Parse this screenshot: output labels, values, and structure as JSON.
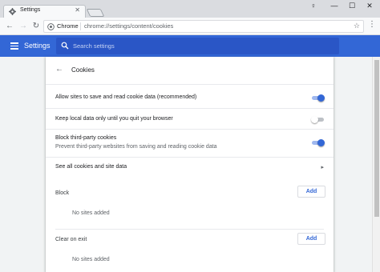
{
  "tab": {
    "title": "Settings",
    "close": "✕"
  },
  "window_controls": {
    "user": "♀",
    "minimize": "—",
    "maximize": "☐",
    "close": "✕"
  },
  "toolbar": {
    "back": "←",
    "forward": "→",
    "reload": "↻",
    "chip": "Chrome",
    "url": "chrome://settings/content/cookies",
    "star": "☆",
    "menu": "⋮"
  },
  "header": {
    "title": "Settings",
    "search_placeholder": "Search settings"
  },
  "page": {
    "back": "←",
    "title": "Cookies"
  },
  "settings": [
    {
      "label": "Allow sites to save and read cookie data (recommended)",
      "enabled": true
    },
    {
      "label": "Keep local data only until you quit your browser",
      "enabled": false
    },
    {
      "label": "Block third-party cookies",
      "sublabel": "Prevent third-party websites from saving and reading cookie data",
      "enabled": true
    }
  ],
  "see_all": {
    "label": "See all cookies and site data",
    "chevron": "▸"
  },
  "lists": {
    "block": {
      "label": "Block",
      "add": "Add",
      "empty": "No sites added"
    },
    "clear_on_exit": {
      "label": "Clear on exit",
      "add": "Add",
      "empty": "No sites added"
    }
  },
  "colors": {
    "accent": "#3367d6",
    "header_bg": "#3367d6",
    "search_bg": "#2a56c6"
  }
}
